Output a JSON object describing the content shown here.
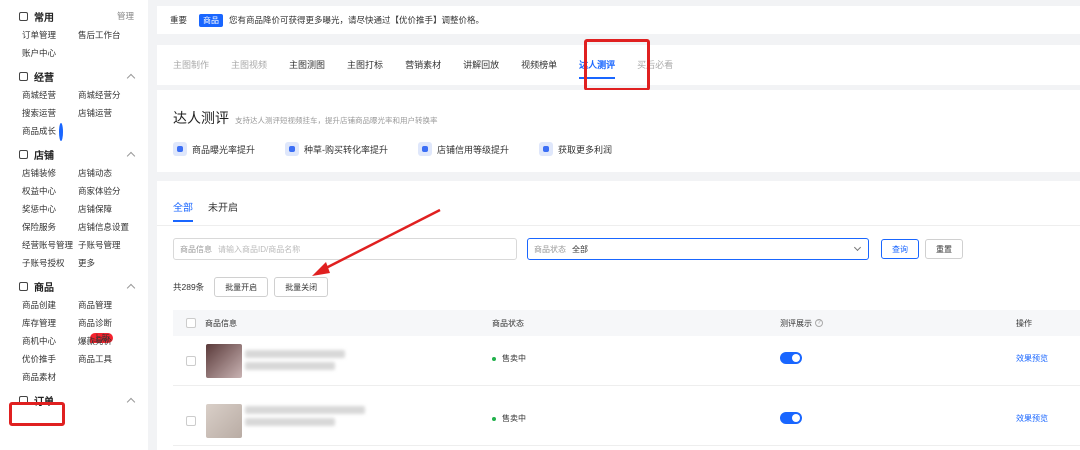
{
  "sidebar": {
    "sections": [
      {
        "title": "常用",
        "action": "管理",
        "items": [
          "订单管理",
          "售后工作台",
          "账户中心"
        ]
      },
      {
        "title": "经营",
        "items": [
          "商城经营",
          "商城经营分",
          "搜索运营",
          "店铺运营",
          "商品成长"
        ]
      },
      {
        "title": "店铺",
        "items": [
          "店铺装修",
          "店铺动态",
          "权益中心",
          "商家体验分",
          "奖惩中心",
          "店铺保障",
          "保险服务",
          "店铺信息设置",
          "经营账号管理",
          "子账号管理",
          "子账号授权",
          "更多"
        ]
      },
      {
        "title": "商品",
        "items": [
          "商品创建",
          "商品管理",
          "库存管理",
          "商品诊断",
          "商机中心",
          "爆款竞价",
          "优价推手",
          "商品工具",
          "商品素材"
        ],
        "new_badge": "上新"
      },
      {
        "title": "订单"
      }
    ]
  },
  "notice": {
    "important": "重要",
    "tag": "商品",
    "message": "您有商品降价可获得更多曝光，请尽快通过【优价推手】调整价格。"
  },
  "tabs": [
    "主图制作",
    "主图视频",
    "主图测图",
    "主图打标",
    "营销素材",
    "讲解回放",
    "视频榜单",
    "达人测评",
    "买后必看"
  ],
  "intro": {
    "title": "达人测评",
    "desc": "支持达人测评短视频挂车，提升店铺商品曝光率和用户转换率",
    "features": [
      "商品曝光率提升",
      "种草-购买转化率提升",
      "店铺信用等级提升",
      "获取更多利润"
    ]
  },
  "panel": {
    "subtabs": [
      "全部",
      "未开启"
    ],
    "search": {
      "info_label": "商品信息",
      "info_placeholder": "请输入商品ID/商品名称",
      "status_label": "商品状态",
      "status_value": "全部",
      "query": "查询",
      "reset": "重置"
    },
    "count": "共289条",
    "batch_open": "批量开启",
    "batch_close": "批量关闭",
    "columns": {
      "info": "商品信息",
      "status": "商品状态",
      "eval": "测评展示",
      "op": "操作"
    },
    "rows": [
      {
        "status": "售卖中",
        "op": "效果预览"
      },
      {
        "status": "售卖中",
        "op": "效果预览"
      }
    ]
  },
  "colors": {
    "accent": "#1966ff",
    "highlight": "#e02020"
  }
}
